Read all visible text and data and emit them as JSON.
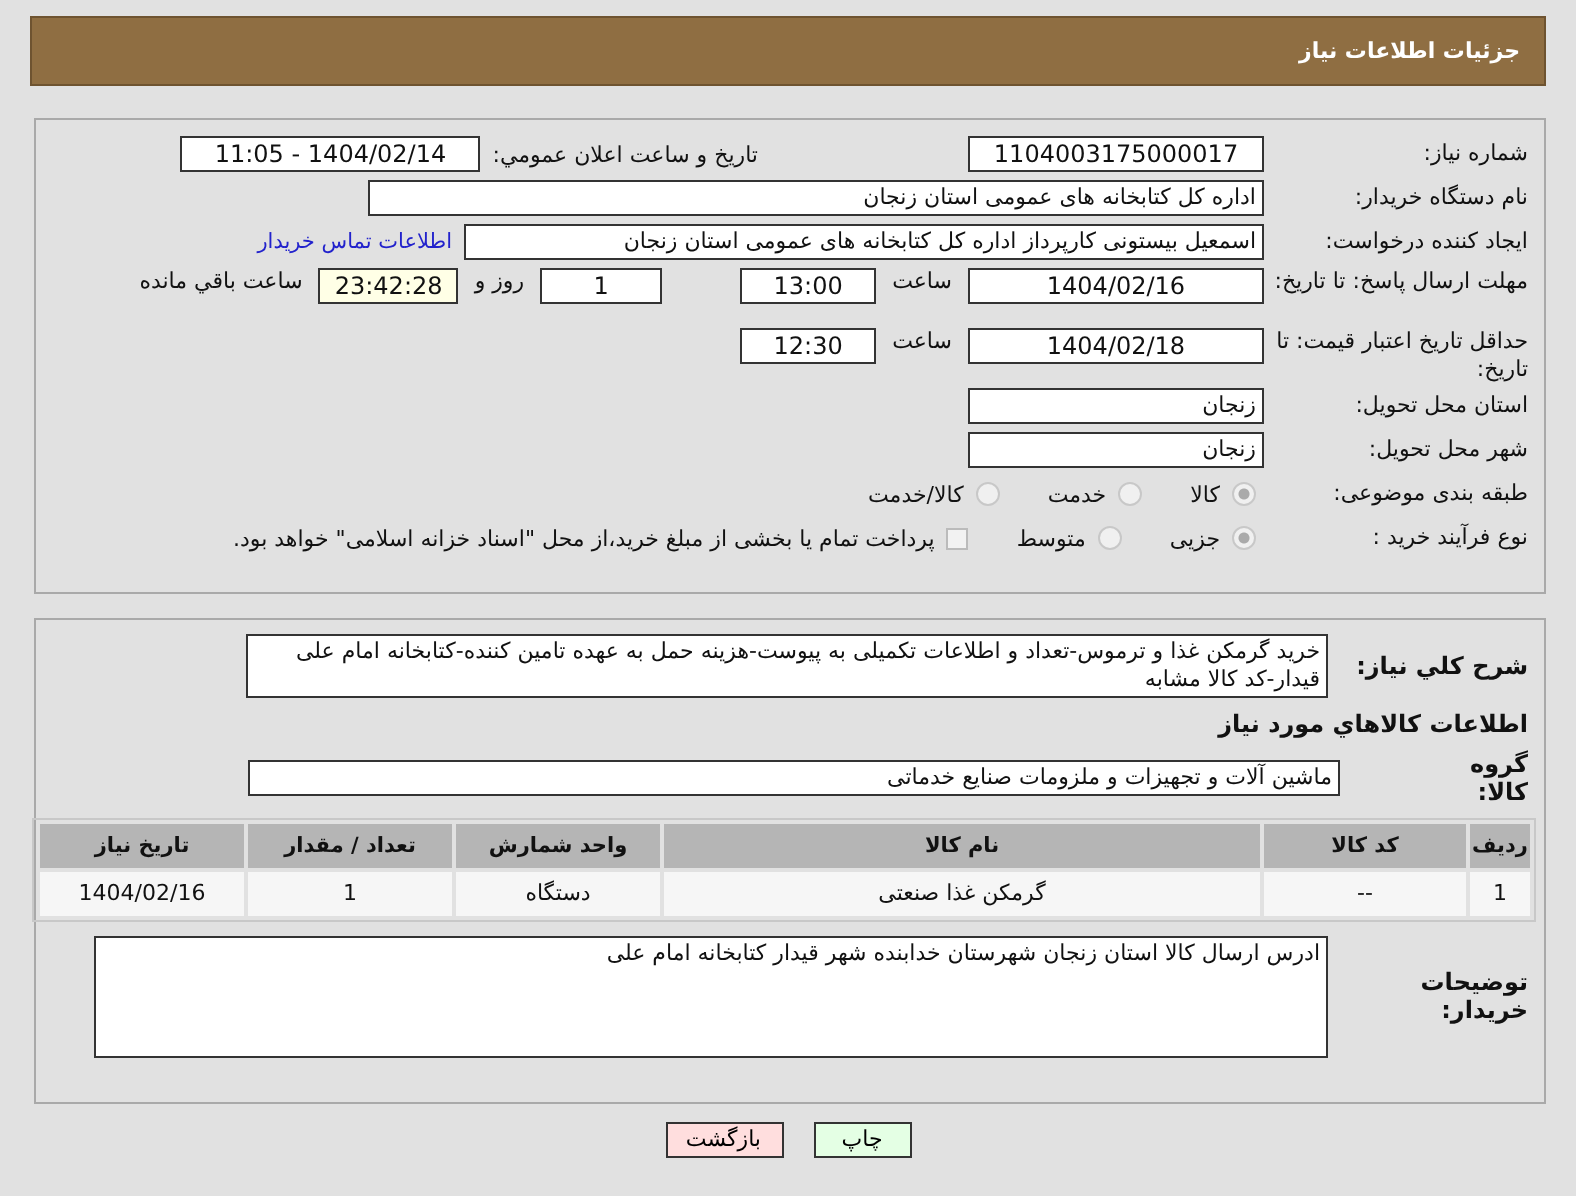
{
  "header": {
    "title": "جزئیات اطلاعات نیاز"
  },
  "need_number": {
    "label": "شماره نیاز:",
    "value": "1104003175000017"
  },
  "announce_datetime": {
    "label": "تاريخ و ساعت اعلان عمومي:",
    "value": "1404/02/14 - 11:05"
  },
  "buyer_org": {
    "label": "نام دستگاه خریدار:",
    "value": "اداره کل کتابخانه های عمومی استان زنجان"
  },
  "requester": {
    "label": "ایجاد کننده درخواست:",
    "value": "اسمعیل بیستونی کارپرداز اداره کل کتابخانه های عمومی استان زنجان",
    "contact_link": "اطلاعات تماس خریدار"
  },
  "response_deadline": {
    "label": "مهلت ارسال پاسخ: تا تاریخ:",
    "date": "1404/02/16",
    "time_label": "ساعت",
    "time": "13:00",
    "days": "1",
    "days_label": "روز و",
    "remaining": "23:42:28",
    "remaining_label": "ساعت باقي مانده"
  },
  "price_validity": {
    "label": "حداقل تاریخ اعتبار قیمت: تا تاریخ:",
    "date": "1404/02/18",
    "time_label": "ساعت",
    "time": "12:30"
  },
  "delivery_province": {
    "label": "استان محل تحویل:",
    "value": "زنجان"
  },
  "delivery_city": {
    "label": "شهر محل تحویل:",
    "value": "زنجان"
  },
  "category": {
    "label": "طبقه بندی موضوعی:",
    "options": [
      {
        "label": "کالا",
        "selected": true
      },
      {
        "label": "خدمت",
        "selected": false
      },
      {
        "label": "کالا/خدمت",
        "selected": false
      }
    ]
  },
  "purchase_process": {
    "label": "نوع فرآیند خرید :",
    "options": [
      {
        "label": "جزیی",
        "selected": true
      },
      {
        "label": "متوسط",
        "selected": false
      }
    ],
    "treasury": {
      "label": "پرداخت تمام یا بخشی از مبلغ خرید،از محل \"اسناد خزانه اسلامی\" خواهد بود.",
      "checked": false
    }
  },
  "description": {
    "label": "شرح كلي نياز:",
    "value": "خرید گرمکن غذا و ترموس-تعداد و اطلاعات تکمیلی به پیوست-هزینه حمل به عهده تامین کننده-کتابخانه امام علی قیدار-کد کالا مشابه"
  },
  "goods_heading": "اطلاعات كالاهاي مورد نياز",
  "goods_group": {
    "label": "گروه کالا:",
    "value": "ماشین آلات و تجهیزات و ملزومات صنایع خدماتی"
  },
  "table": {
    "columns": [
      "ردیف",
      "کد کالا",
      "نام کالا",
      "واحد شمارش",
      "تعداد / مقدار",
      "تاریخ نیاز"
    ],
    "rows": [
      [
        "1",
        "--",
        "گرمکن غذا صنعتی",
        "دستگاه",
        "1",
        "1404/02/16"
      ]
    ]
  },
  "buyer_notes": {
    "label": "توضیحات خریدار:",
    "value": "ادرس ارسال کالا استان زنجان شهرستان خدابنده شهر قیدار کتابخانه امام علی"
  },
  "buttons": [
    {
      "label": "چاپ",
      "kind": "print"
    },
    {
      "label": "بازگشت",
      "kind": "back"
    }
  ]
}
